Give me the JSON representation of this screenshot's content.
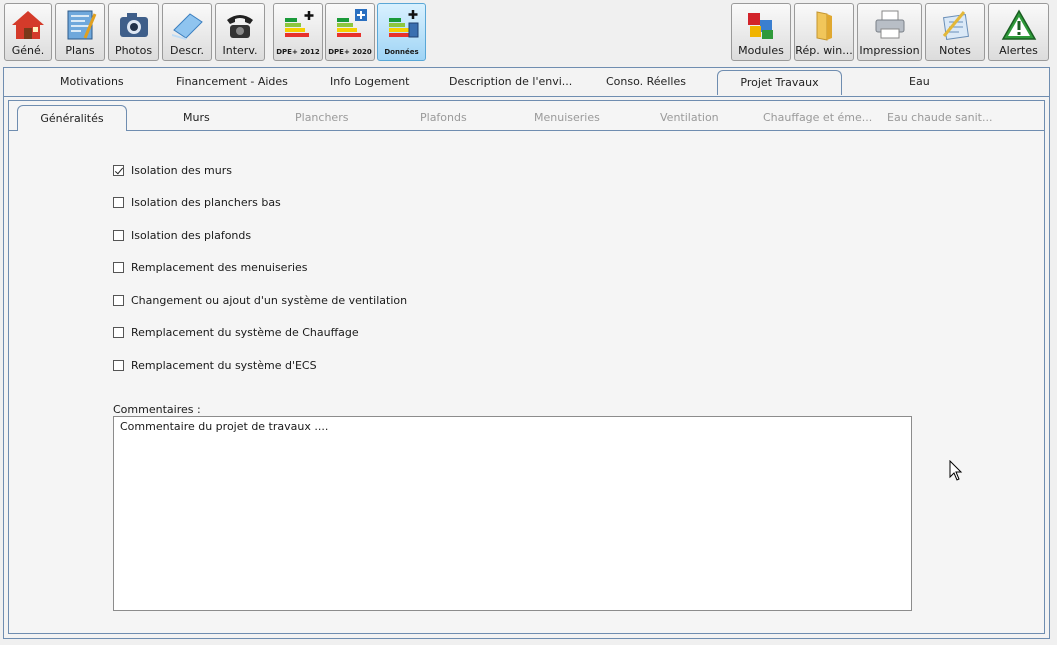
{
  "toolbar_left": [
    {
      "label": "Géné.",
      "icon": "house-icon"
    },
    {
      "label": "Plans",
      "icon": "plans-icon"
    },
    {
      "label": "Photos",
      "icon": "camera-icon"
    },
    {
      "label": "Descr.",
      "icon": "description-icon"
    },
    {
      "label": "Interv.",
      "icon": "telephone-icon"
    }
  ],
  "toolbar_dpe": [
    {
      "label": "DPE+ 2012",
      "icon": "energy-label-plus-icon"
    },
    {
      "label": "DPE+ 2020",
      "icon": "energy-label-plus-icon"
    },
    {
      "label": "Données",
      "icon": "energy-label-data-icon",
      "active": true
    }
  ],
  "toolbar_right": [
    {
      "label": "Modules",
      "icon": "puzzle-icon"
    },
    {
      "label": "Rép. win...",
      "icon": "folder-icon"
    },
    {
      "label": "Impression",
      "icon": "printer-icon"
    },
    {
      "label": "Notes",
      "icon": "notes-icon"
    },
    {
      "label": "Alertes",
      "icon": "alert-icon"
    }
  ],
  "main_tabs": [
    "Motivations",
    "Financement  - Aides",
    "Info Logement",
    "Description de l'envi...",
    "Conso. Réelles",
    "Projet Travaux",
    "Eau"
  ],
  "main_tabs_selected": "Projet Travaux",
  "sub_tabs": [
    "Généralités",
    "Murs",
    "Planchers",
    "Plafonds",
    "Menuiseries",
    "Ventilation",
    "Chauffage et éme...",
    "Eau chaude sanit..."
  ],
  "sub_tabs_selected": "Généralités",
  "checkboxes": [
    {
      "label": "Isolation des murs",
      "checked": true
    },
    {
      "label": "Isolation des planchers bas",
      "checked": false
    },
    {
      "label": "Isolation des plafonds",
      "checked": false
    },
    {
      "label": "Remplacement des menuiseries",
      "checked": false
    },
    {
      "label": "Changement ou ajout d'un système de ventilation",
      "checked": false
    },
    {
      "label": "Remplacement du système de Chauffage",
      "checked": false
    },
    {
      "label": "Remplacement du système d'ECS",
      "checked": false
    }
  ],
  "comments": {
    "label": "Commentaires :",
    "value": "Commentaire du projet de travaux ...."
  }
}
